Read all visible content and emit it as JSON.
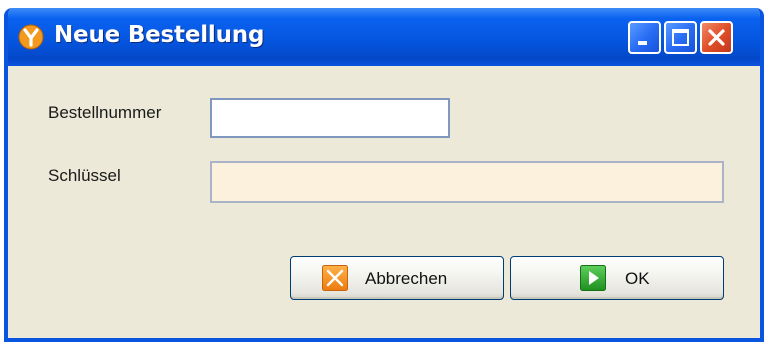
{
  "window": {
    "title": "Neue Bestellung",
    "app_icon": "y-logo-icon",
    "controls": [
      "minimize-icon",
      "maximize-icon",
      "close-icon"
    ]
  },
  "form": {
    "bestellnummer": {
      "label": "Bestellnummer",
      "value": ""
    },
    "schluessel": {
      "label": "Schlüssel",
      "value": "",
      "readonly": true
    }
  },
  "buttons": {
    "cancel": {
      "label": "Abbrechen",
      "icon": "cancel-x-icon"
    },
    "ok": {
      "label": "OK",
      "icon": "play-arrow-icon"
    }
  },
  "colors": {
    "titlebar": "#0556e0",
    "window_bg": "#ece9d8",
    "readonly_field_bg": "#fbf1dc",
    "cancel_icon": "#f08a1a",
    "ok_icon": "#2ea52e",
    "close_button": "#e0502a"
  }
}
